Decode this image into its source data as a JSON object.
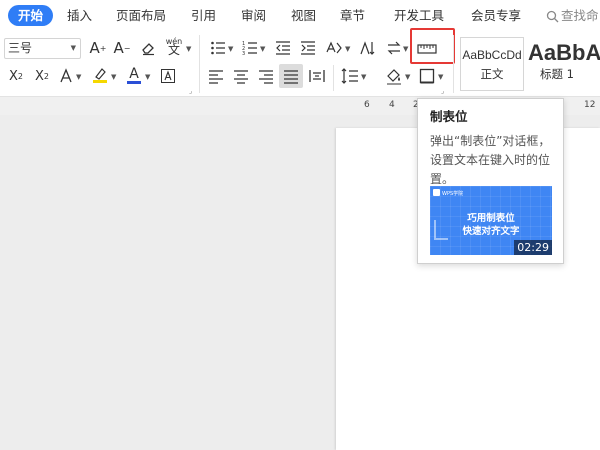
{
  "menu": {
    "tabs": [
      "开始",
      "插入",
      "页面布局",
      "引用",
      "审阅",
      "视图",
      "章节",
      "开发工具",
      "会员专享"
    ],
    "search_label": "查找命"
  },
  "ribbon": {
    "font_size": "三号",
    "styles": [
      {
        "sample": "AaBbCcDd",
        "name": "正文"
      },
      {
        "sample": "AaBbA",
        "name": "标题 1"
      }
    ],
    "pinyin_label": "wén"
  },
  "ruler": {
    "numbers": [
      "6",
      "4",
      "2",
      "12"
    ]
  },
  "tooltip": {
    "title": "制表位",
    "description": "弹出“制表位”对话框，设置文本在键入时的位置。",
    "thumbnail_brand": "WPS学院",
    "thumbnail_line1": "巧用制表位",
    "thumbnail_line2": "快速对齐文字",
    "duration": "02:29"
  },
  "colors": {
    "accent": "#2f7df6",
    "highlight_border": "#e53935",
    "highlighter_yellow": "#f5d800",
    "font_color_blue": "#2a4fd6",
    "thumbnail_blue": "#3f86f3"
  }
}
